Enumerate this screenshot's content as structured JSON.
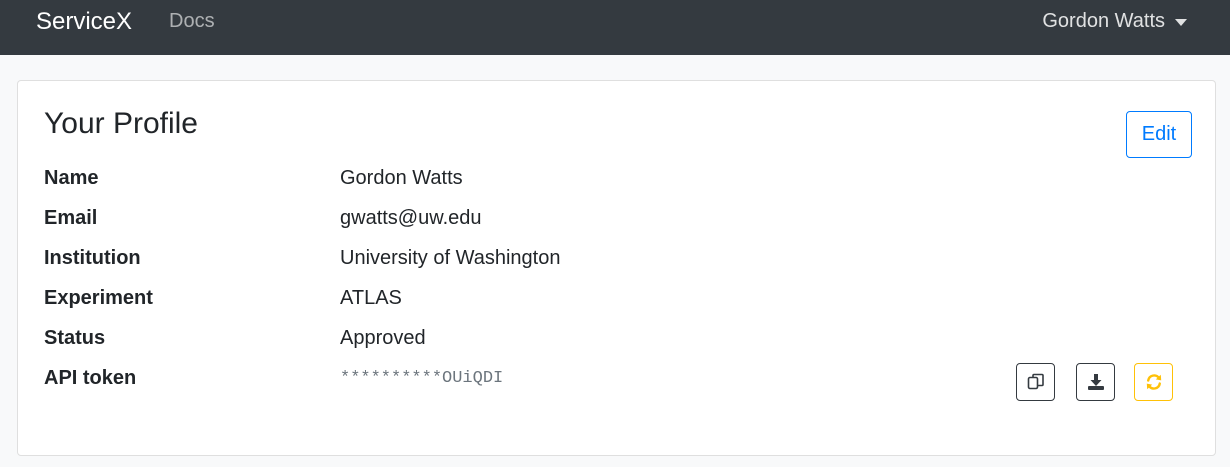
{
  "navbar": {
    "brand": "ServiceX",
    "docs_link": "Docs",
    "user_name": "Gordon Watts"
  },
  "profile": {
    "title": "Your Profile",
    "edit_label": "Edit",
    "fields": [
      {
        "label": "Name",
        "value": "Gordon Watts"
      },
      {
        "label": "Email",
        "value": "gwatts@uw.edu"
      },
      {
        "label": "Institution",
        "value": "University of Washington"
      },
      {
        "label": "Experiment",
        "value": "ATLAS"
      },
      {
        "label": "Status",
        "value": "Approved"
      },
      {
        "label": "API token",
        "value": "**********OUiQDI"
      }
    ],
    "token_actions": [
      {
        "icon": "copy-icon",
        "color": "#343a40"
      },
      {
        "icon": "download-icon",
        "color": "#343a40"
      },
      {
        "icon": "refresh-icon",
        "color": "#ffc107"
      }
    ]
  },
  "colors": {
    "navbar_bg": "#343a40",
    "primary": "#007bff",
    "warning": "#ffc107",
    "page_bg": "#f8f9fa"
  }
}
